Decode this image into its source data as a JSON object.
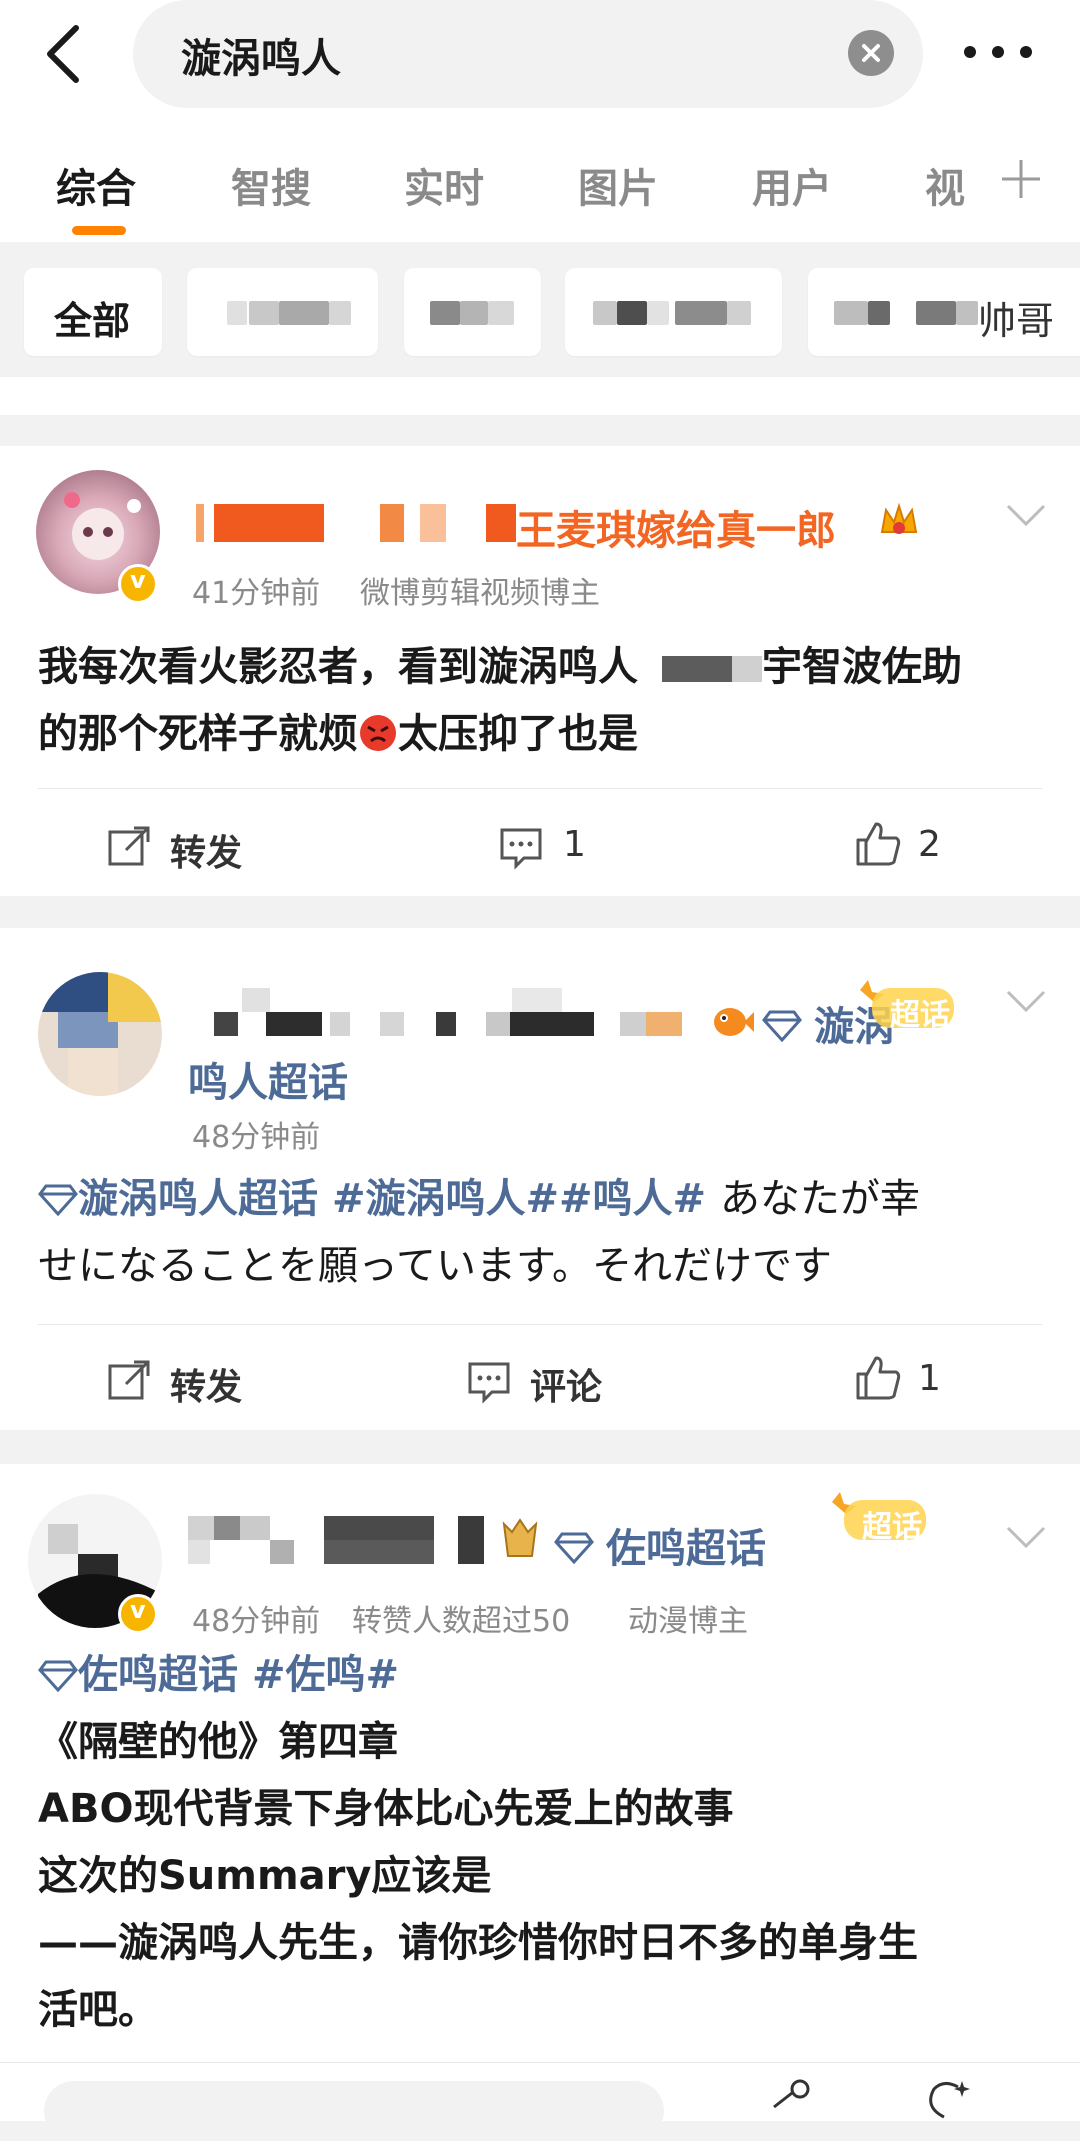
{
  "search": {
    "query": "漩涡鸣人"
  },
  "tabs": [
    {
      "label": "综合",
      "active": true
    },
    {
      "label": "智搜"
    },
    {
      "label": "实时"
    },
    {
      "label": "图片"
    },
    {
      "label": "用户"
    },
    {
      "label": "视"
    }
  ],
  "filters": {
    "all_label": "全部",
    "last_chip_tail": "帅哥"
  },
  "posts": [
    {
      "username_visible": "王麦琪嫁给真一郎",
      "time": "41分钟前",
      "source": "微博剪辑视频博主",
      "text_line1_a": "我每次看火影忍者，看到漩涡鸣人",
      "text_line1_b": "宇智波佐助",
      "text_line2_a": "的那个死样子就烦",
      "text_line2_b": "太压抑了也是",
      "repost_label": "转发",
      "comment_count": "1",
      "like_count": "2"
    },
    {
      "supertopic_line1": "漩涡",
      "supertopic_line2": "鸣人超话",
      "badge_label": "超话",
      "time": "48分钟前",
      "tag1": "漩涡鸣人超话",
      "tag2": "#漩涡鸣人##鸣人#",
      "text_line1_tail": "あなたが幸",
      "text_line2": "せになることを願っています。それだけです",
      "repost_label": "转发",
      "comment_label": "评论",
      "like_count": "1"
    },
    {
      "supertopic": "佐鸣超话",
      "badge_label": "超话",
      "time": "48分钟前",
      "meta_extra": "转赞人数超过50",
      "source": "动漫博主",
      "tag1": "佐鸣超话",
      "tag2": "#佐鸣#",
      "line1": "《隔壁的他》第四章",
      "line2": "ABO现代背景下身体比心先爱上的故事",
      "line3": "这次的Summary应该是",
      "line4": "——漩涡鸣人先生，请你珍惜你时日不多的单身生",
      "line5": "活吧。"
    }
  ],
  "colors": {
    "accent": "#ff8200",
    "link": "#4d6b96",
    "username_orange": "#f26522",
    "badge_yellow": "#f7b500"
  }
}
